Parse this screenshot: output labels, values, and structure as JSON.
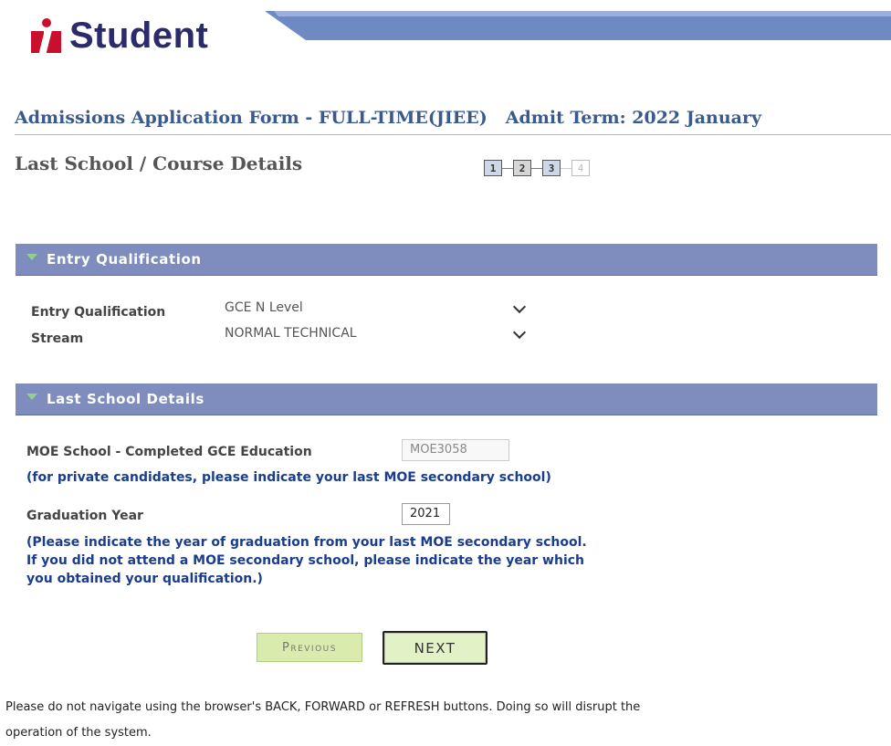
{
  "brand": {
    "logo_text": "Student",
    "brand_color": "#c8102e",
    "text_color": "#2b2a6b"
  },
  "header": {
    "form_title": "Admissions Application Form - FULL-TIME(JIEE)",
    "admit_term": "Admit Term: 2022 January",
    "subtitle": "Last School / Course Details"
  },
  "steps": [
    {
      "label": "1",
      "state": "done"
    },
    {
      "label": "2",
      "state": "current"
    },
    {
      "label": "3",
      "state": "done"
    },
    {
      "label": "4",
      "state": "future"
    }
  ],
  "entry_qualification": {
    "header": "Entry Qualification",
    "qualification_label": "Entry Qualification",
    "qualification_value": "GCE N Level",
    "stream_label": "Stream",
    "stream_value": "NORMAL TECHNICAL"
  },
  "last_school": {
    "header": "Last School Details",
    "moe_label": "MOE School - Completed GCE Education",
    "moe_value": "MOE3058",
    "moe_note": "(for private candidates, please indicate your last MOE secondary school)",
    "grad_label": "Graduation Year",
    "grad_value": "2021",
    "grad_note_1": "(Please indicate the year of graduation from your last MOE secondary school.",
    "grad_note_2": "If you did not attend a MOE secondary school, please indicate the year which",
    "grad_note_3": "you obtained your qualification.)"
  },
  "buttons": {
    "previous": "Previous",
    "next": "NEXT"
  },
  "footer": {
    "line1": "Please do not navigate using the browser's BACK, FORWARD or REFRESH buttons. Doing so will disrupt the",
    "line2": "operation of the system."
  },
  "colors": {
    "section_header": "#7e8dbd",
    "title": "#3a5a8c",
    "note": "#1a3d8f",
    "button": "#e3f2c6"
  }
}
